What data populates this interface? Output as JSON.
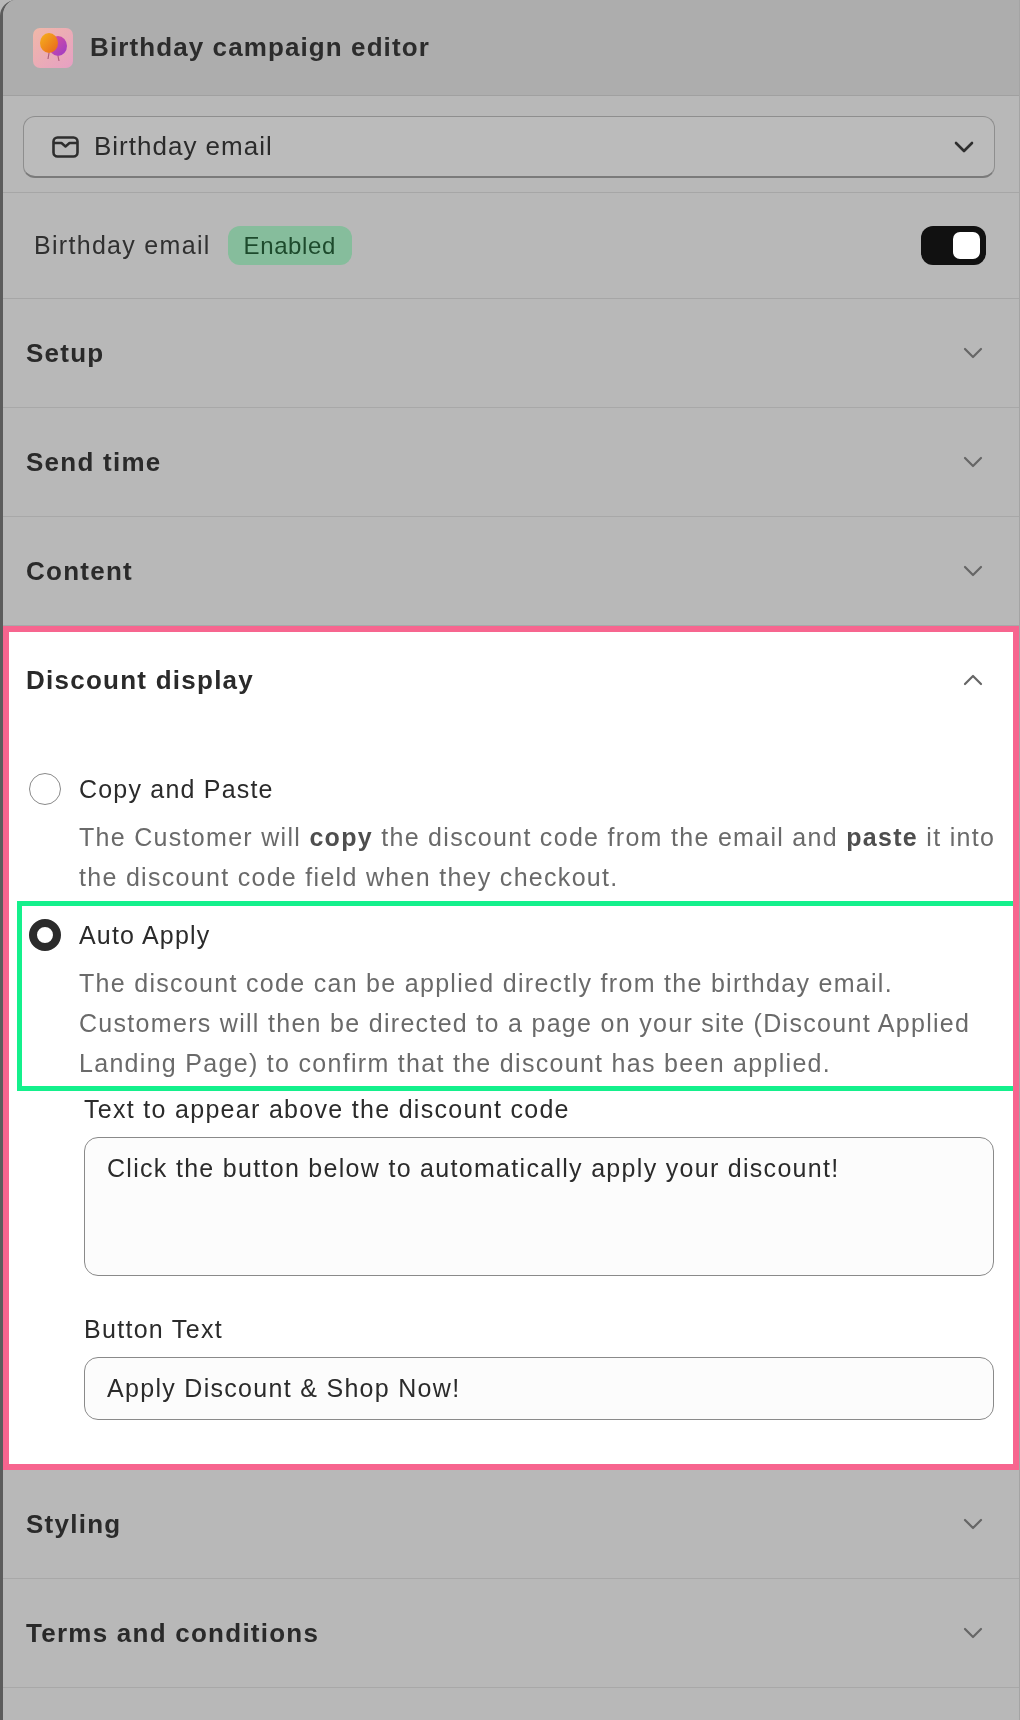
{
  "header": {
    "title": "Birthday campaign editor"
  },
  "campaign_select": {
    "value": "Birthday email"
  },
  "status_row": {
    "label": "Birthday email",
    "badge": "Enabled",
    "on": true
  },
  "sections": [
    {
      "title": "Setup",
      "expanded": false,
      "highlighted": false
    },
    {
      "title": "Send time",
      "expanded": false,
      "highlighted": false
    },
    {
      "title": "Content",
      "expanded": false,
      "highlighted": false
    },
    {
      "title": "Discount display",
      "expanded": true,
      "highlighted": true,
      "options": [
        {
          "label": "Copy and Paste",
          "description": "The Customer will **copy** the discount code from the email and **paste** it into the discount code field when they checkout.",
          "selected": false,
          "highlighted": false
        },
        {
          "label": "Auto Apply",
          "description": "The discount code can be applied directly from the birthday email. Customers will then be directed to a page on your site (Discount Applied Landing Page) to confirm that the discount has been applied.",
          "selected": true,
          "highlighted": true
        }
      ],
      "fields": [
        {
          "kind": "textarea",
          "label": "Text to appear above the discount code",
          "value": "Click the button below to automatically apply your discount!"
        },
        {
          "kind": "input",
          "label": "Button Text",
          "value": "Apply Discount & Shop Now!"
        }
      ]
    },
    {
      "title": "Styling",
      "expanded": false,
      "highlighted": false
    },
    {
      "title": "Terms and conditions",
      "expanded": false,
      "highlighted": false
    }
  ]
}
